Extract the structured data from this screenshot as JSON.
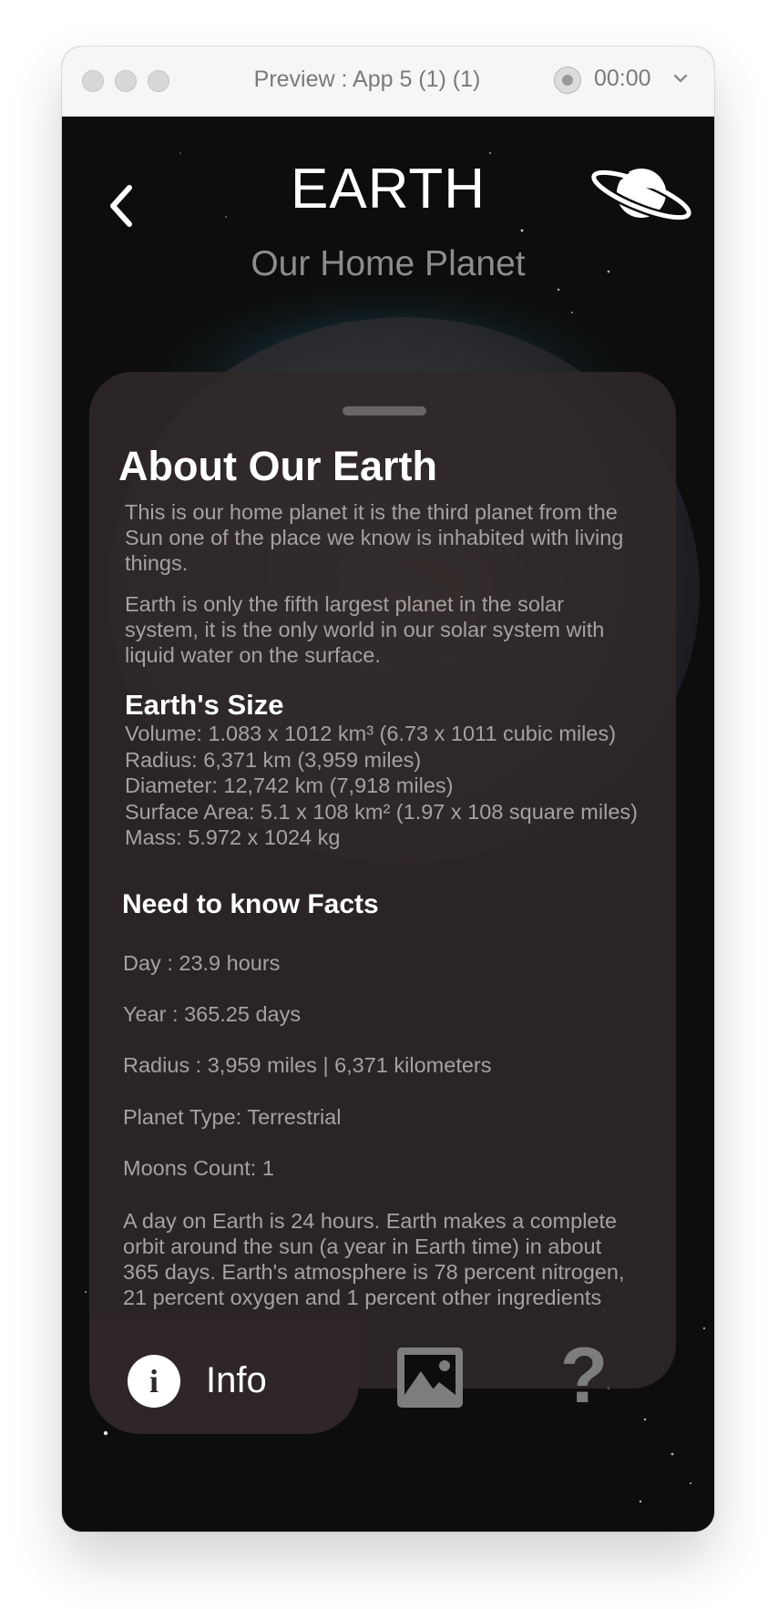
{
  "window": {
    "title": "Preview : App 5 (1) (1)",
    "timer": "00:00"
  },
  "header": {
    "title": "EARTH",
    "subtitle": "Our Home Planet"
  },
  "card": {
    "heading": "About Our Earth",
    "intro": [
      "This is our home planet it is the third planet from the",
      "Sun one of the place we know is inhabited with living",
      "things."
    ],
    "intro2": [
      "Earth is only the fifth largest planet in the solar",
      "system, it is the only world in our solar system with",
      "liquid water on the surface."
    ],
    "size_heading": "Earth's Size",
    "size_lines": [
      "Volume: 1.083 x 1012 km³ (6.73 x 1011 cubic miles)",
      "Radius: 6,371 km (3,959 miles)",
      "Diameter: 12,742 km (7,918 miles)",
      "Surface Area: 5.1 x 108 km² (1.97 x 108 square miles)",
      "Mass: 5.972 x 1024 kg"
    ],
    "facts_heading": "Need to know Facts",
    "facts": [
      "Day :  23.9 hours",
      "Year : 365.25 days",
      "Radius : 3,959 miles | 6,371 kilometers",
      "Planet Type: Terrestrial",
      "Moons Count: 1"
    ],
    "summary": [
      "A day on Earth is 24 hours. Earth makes a complete",
      "orbit around the sun (a year in Earth time) in about",
      "365 days. Earth's atmosphere is 78 percent nitrogen,",
      "21 percent oxygen and 1 percent other ingredients"
    ]
  },
  "tabs": {
    "info_icon": "i",
    "info_label": "Info",
    "help_icon": "?"
  },
  "icons": {
    "back": "chevron-left-icon",
    "planet": "saturn-icon",
    "gallery": "image-icon",
    "help": "question-mark-icon",
    "info": "info-icon"
  },
  "colors": {
    "background": "#0d0d0d",
    "card": "#302828",
    "title_text": "#ffffff",
    "body_text": "#a6a1a1",
    "inactive_icon": "#7d7d7d",
    "glow": "#28788c"
  }
}
